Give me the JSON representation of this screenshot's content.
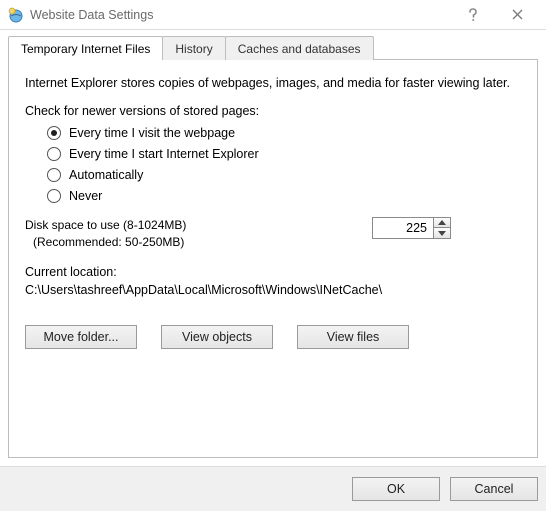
{
  "window": {
    "title": "Website Data Settings"
  },
  "tabs": {
    "temp": "Temporary Internet Files",
    "history": "History",
    "caches": "Caches and databases"
  },
  "intro": "Internet Explorer stores copies of webpages, images, and media for faster viewing later.",
  "check_label": "Check for newer versions of stored pages:",
  "radios": {
    "r0": "Every time I visit the webpage",
    "r1": "Every time I start Internet Explorer",
    "r2": "Automatically",
    "r3": "Never"
  },
  "disk": {
    "label": "Disk space to use (8-1024MB)",
    "recommended": "(Recommended: 50-250MB)",
    "value": "225"
  },
  "location": {
    "label": "Current location:",
    "path": "C:\\Users\\tashreef\\AppData\\Local\\Microsoft\\Windows\\INetCache\\"
  },
  "buttons": {
    "move": "Move folder...",
    "objects": "View objects",
    "files": "View files",
    "ok": "OK",
    "cancel": "Cancel"
  }
}
